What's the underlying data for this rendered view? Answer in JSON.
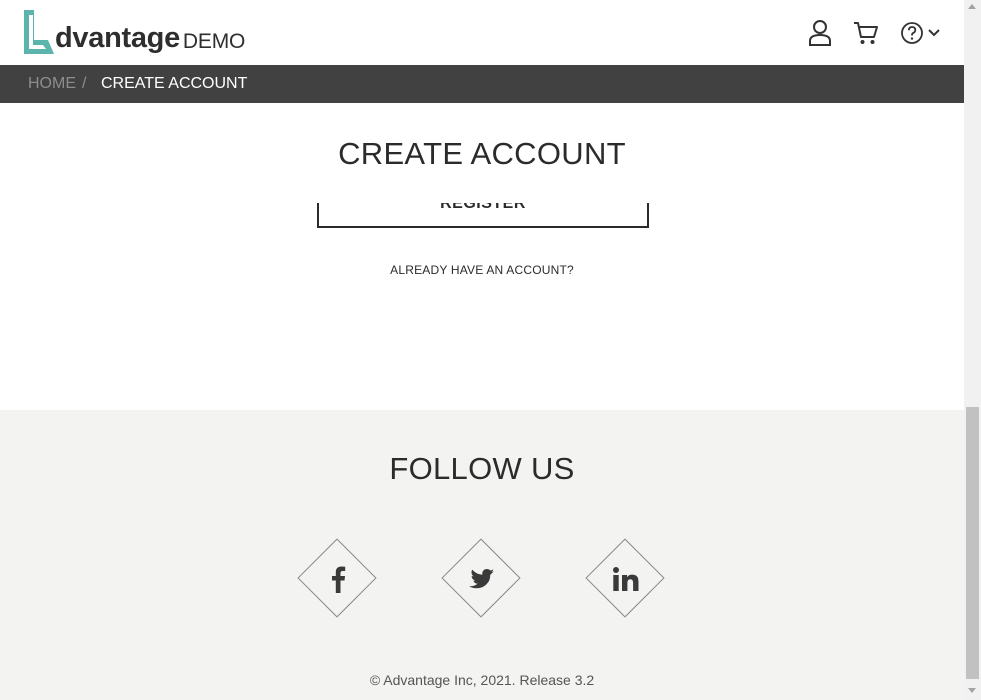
{
  "header": {
    "logo_text": "dvantage",
    "logo_suffix": "DEMO",
    "icons": [
      "user-icon",
      "cart-icon",
      "help-icon",
      "chevron-down-icon"
    ],
    "accent_color": "#5bb5ad"
  },
  "breadcrumb": {
    "home": "HOME",
    "separator": "/",
    "current": "CREATE ACCOUNT"
  },
  "main": {
    "title": "CREATE ACCOUNT",
    "register_label": "REGISTER",
    "already_link": "ALREADY HAVE AN ACCOUNT?"
  },
  "footer": {
    "title": "FOLLOW US",
    "social": [
      {
        "name": "facebook",
        "icon": "facebook-icon"
      },
      {
        "name": "twitter",
        "icon": "twitter-icon"
      },
      {
        "name": "linkedin",
        "icon": "linkedin-icon"
      }
    ],
    "copyright": "© Advantage Inc, 2021. Release 3.2"
  }
}
